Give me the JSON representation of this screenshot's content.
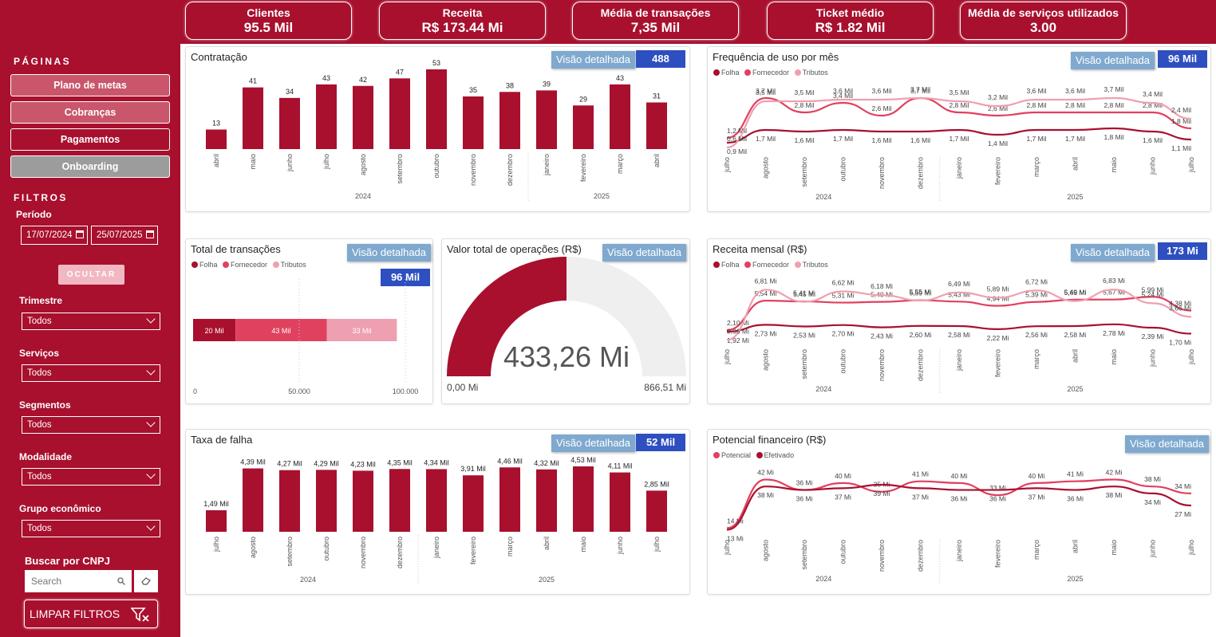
{
  "kpis": [
    {
      "label": "Clientes",
      "value": "95.5 Mil"
    },
    {
      "label": "Receita",
      "value": "R$ 173.44 Mi"
    },
    {
      "label": "Média de transações",
      "value": "7,35 Mil"
    },
    {
      "label": "Ticket médio",
      "value": "R$ 1.82 Mil"
    },
    {
      "label": "Média de serviços utilizados",
      "value": "3.00"
    }
  ],
  "sidebar": {
    "pages_heading": "PÁGINAS",
    "pages": [
      "Plano de metas",
      "Cobranças",
      "Pagamentos",
      "Onboarding"
    ],
    "filters_heading": "FILTROS",
    "period_label": "Período",
    "date_start": "17/07/2024",
    "date_end": "25/07/2025",
    "hide_button": "OCULTAR",
    "filters": [
      {
        "label": "Trimestre",
        "value": "Todos"
      },
      {
        "label": "Serviços",
        "value": "Todos"
      },
      {
        "label": "Segmentos",
        "value": "Todos"
      },
      {
        "label": "Modalidade",
        "value": "Todos"
      },
      {
        "label": "Grupo econômico",
        "value": "Todos"
      }
    ],
    "cnpj_label": "Buscar por CNPJ",
    "search_placeholder": "Search",
    "clear_button": "LIMPAR FILTROS"
  },
  "common": {
    "detail_button": "Visão detalhada",
    "year1": "2024",
    "year2": "2025"
  },
  "colors": {
    "brand": "#A8102E",
    "folha": "#A8102E",
    "fornecedor": "#E0415F",
    "tributos": "#EFA0B0",
    "badge": "#2E4FC0",
    "button_blue": "#7FA9CF"
  },
  "chart_data": [
    {
      "id": "contratacao",
      "type": "bar",
      "title": "Contratação",
      "badge": "488",
      "categories": [
        "abril",
        "maio",
        "junho",
        "julho",
        "agosto",
        "setembro",
        "outubro",
        "novembro",
        "dezembro",
        "janeiro",
        "fevereiro",
        "março",
        "abril"
      ],
      "years": [
        {
          "label": "2024",
          "count": 9
        },
        {
          "label": "2025",
          "count": 4
        }
      ],
      "values": [
        13,
        41,
        34,
        43,
        42,
        47,
        53,
        35,
        38,
        39,
        29,
        43,
        31
      ],
      "labels": [
        "13",
        "41",
        "34",
        "43",
        "42",
        "47",
        "53",
        "35",
        "38",
        "39",
        "29",
        "43",
        "31"
      ]
    },
    {
      "id": "frequencia",
      "type": "line",
      "title": "Frequência de uso por mês",
      "badge": "96 Mil",
      "categories": [
        "julho",
        "agosto",
        "setembro",
        "outubro",
        "novembro",
        "dezembro",
        "janeiro",
        "fevereiro",
        "março",
        "abril",
        "maio",
        "junho",
        "julho"
      ],
      "legend": [
        "Folha",
        "Fornecedor",
        "Tributos"
      ],
      "series": [
        {
          "name": "Folha",
          "values": [
            0.9,
            1.7,
            1.6,
            1.7,
            1.6,
            1.6,
            1.7,
            1.4,
            1.7,
            1.7,
            1.8,
            1.6,
            1.1
          ],
          "labels": [
            "0,9 Mil",
            "1,7 Mil",
            "1,6 Mil",
            "1,7 Mil",
            "1,6 Mil",
            "1,6 Mil",
            "1,7 Mil",
            "1,4 Mil",
            "1,7 Mil",
            "1,7 Mil",
            "1,8 Mil",
            "1,6 Mil",
            "1,1 Mil"
          ]
        },
        {
          "name": "Fornecedor",
          "values": [
            1.2,
            3.7,
            2.8,
            3.4,
            2.6,
            3.7,
            2.8,
            2.6,
            2.8,
            2.8,
            2.8,
            2.8,
            1.8
          ],
          "labels": [
            "1,2 Mil",
            "3,7 Mil",
            "2,8 Mil",
            "3,4 Mil",
            "2,6 Mil",
            "3,7 Mil",
            "2,8 Mil",
            "2,6 Mil",
            "2,8 Mil",
            "2,8 Mil",
            "2,8 Mil",
            "2,8 Mil",
            "1,8 Mil"
          ]
        },
        {
          "name": "Tributos",
          "values": [
            0.6,
            3.5,
            3.5,
            3.6,
            3.6,
            3.7,
            3.5,
            3.2,
            3.6,
            3.6,
            3.7,
            3.4,
            2.4
          ],
          "labels": [
            "0,6 Mil",
            "3,5 Mil",
            "3,5 Mil",
            "3,6 Mil",
            "3,6 Mil",
            "3,7 Mil",
            "3,5 Mil",
            "3,2 Mil",
            "3,6 Mil",
            "3,6 Mil",
            "3,7 Mil",
            "3,4 Mil",
            "2,4 Mil"
          ]
        }
      ]
    },
    {
      "id": "transacoes",
      "type": "bar",
      "title": "Total de transações",
      "badge": "96 Mil",
      "legend": [
        "Folha",
        "Fornecedor",
        "Tributos"
      ],
      "series": [
        {
          "name": "Folha",
          "value": 20000,
          "label": "20 Mil"
        },
        {
          "name": "Fornecedor",
          "value": 43000,
          "label": "43 Mil"
        },
        {
          "name": "Tributos",
          "value": 33000,
          "label": "33 Mil"
        }
      ],
      "xticks": [
        "0",
        "50.000",
        "100.000"
      ],
      "xlim": [
        0,
        100000
      ]
    },
    {
      "id": "valor_total",
      "type": "gauge",
      "title": "Valor total de operações (R$)",
      "value_label": "433,26 Mi",
      "min_label": "0,00 Mi",
      "max_label": "866,51 Mi",
      "fraction": 0.5
    },
    {
      "id": "receita",
      "type": "line",
      "title": "Receita mensal (R$)",
      "badge": "173 Mi",
      "categories": [
        "julho",
        "agosto",
        "setembro",
        "outubro",
        "novembro",
        "dezembro",
        "janeiro",
        "fevereiro",
        "março",
        "abril",
        "maio",
        "junho",
        "julho"
      ],
      "legend": [
        "Folha",
        "Fornecedor",
        "Tributos"
      ],
      "series": [
        {
          "name": "Folha",
          "values": [
            1.92,
            2.73,
            2.53,
            2.7,
            2.43,
            2.6,
            2.58,
            2.22,
            2.56,
            2.58,
            2.78,
            2.39,
            1.7
          ],
          "labels": [
            "1,92 Mi",
            "2,73 Mi",
            "2,53 Mi",
            "2,70 Mi",
            "2,43 Mi",
            "2,60 Mi",
            "2,58 Mi",
            "2,22 Mi",
            "2,56 Mi",
            "2,58 Mi",
            "2,78 Mi",
            "2,39 Mi",
            "1,70 Mi"
          ]
        },
        {
          "name": "Fornecedor",
          "values": [
            2.1,
            5.54,
            5.45,
            5.31,
            5.4,
            5.59,
            5.43,
            4.94,
            5.39,
            5.66,
            5.67,
            5.99,
            4.38
          ],
          "labels": [
            "2,10 Mi",
            "5,54 Mi",
            "5,45 Mi",
            "5,31 Mi",
            "5,40 Mi",
            "5,59 Mi",
            "5,43 Mi",
            "4,94 Mi",
            "5,39 Mi",
            "5,66 Mi",
            "5,67 Mi",
            "5,99 Mi",
            "4,38 Mi"
          ]
        },
        {
          "name": "Tributos",
          "values": [
            0.96,
            6.81,
            5.41,
            6.62,
            6.18,
            5.55,
            6.49,
            5.89,
            6.72,
            5.49,
            6.83,
            5.24,
            3.66
          ],
          "labels": [
            "0,96 Mi",
            "6,81 Mi",
            "5,41 Mi",
            "6,62 Mi",
            "6,18 Mi",
            "5,55 Mi",
            "6,49 Mi",
            "5,89 Mi",
            "6,72 Mi",
            "5,49 Mi",
            "6,83 Mi",
            "5,24 Mi",
            "3,66 Mi"
          ]
        }
      ]
    },
    {
      "id": "taxa_falha",
      "type": "bar",
      "title": "Taxa de falha",
      "badge": "52 Mil",
      "categories": [
        "julho",
        "agosto",
        "setembro",
        "outubro",
        "novembro",
        "dezembro",
        "janeiro",
        "fevereiro",
        "março",
        "abril",
        "maio",
        "junho",
        "julho"
      ],
      "years": [
        {
          "label": "2024",
          "count": 6
        },
        {
          "label": "2025",
          "count": 7
        }
      ],
      "values": [
        1.49,
        4.39,
        4.27,
        4.29,
        4.23,
        4.35,
        4.34,
        3.91,
        4.46,
        4.32,
        4.53,
        4.11,
        2.85
      ],
      "labels": [
        "1,49 Mil",
        "4,39 Mil",
        "4,27 Mil",
        "4,29 Mil",
        "4,23 Mil",
        "4,35 Mil",
        "4,34 Mil",
        "3,91 Mil",
        "4,46 Mil",
        "4,32 Mil",
        "4,53 Mil",
        "4,11 Mil",
        "2,85 Mil"
      ]
    },
    {
      "id": "potencial",
      "type": "line",
      "title": "Potencial financeiro (R$)",
      "categories": [
        "julho",
        "agosto",
        "setembro",
        "outubro",
        "novembro",
        "dezembro",
        "janeiro",
        "fevereiro",
        "março",
        "abril",
        "maio",
        "junho",
        "julho"
      ],
      "legend": [
        "Potencial",
        "Efetivado"
      ],
      "series": [
        {
          "name": "Potencial",
          "values": [
            14,
            42,
            36,
            40,
            35,
            41,
            40,
            33,
            40,
            41,
            42,
            38,
            34
          ],
          "labels": [
            "14 Mi",
            "42 Mi",
            "36 Mi",
            "40 Mi",
            "35 Mi",
            "41 Mi",
            "40 Mi",
            "33 Mi",
            "40 Mi",
            "41 Mi",
            "42 Mi",
            "38 Mi",
            "34 Mi"
          ]
        },
        {
          "name": "Efetivado",
          "values": [
            13,
            38,
            36,
            37,
            39,
            37,
            36,
            36,
            37,
            36,
            38,
            34,
            27
          ],
          "labels": [
            "13 Mi",
            "38 Mi",
            "36 Mi",
            "37 Mi",
            "39 Mi",
            "37 Mi",
            "36 Mi",
            "36 Mi",
            "37 Mi",
            "36 Mi",
            "38 Mi",
            "34 Mi",
            "27 Mi"
          ]
        }
      ]
    }
  ]
}
